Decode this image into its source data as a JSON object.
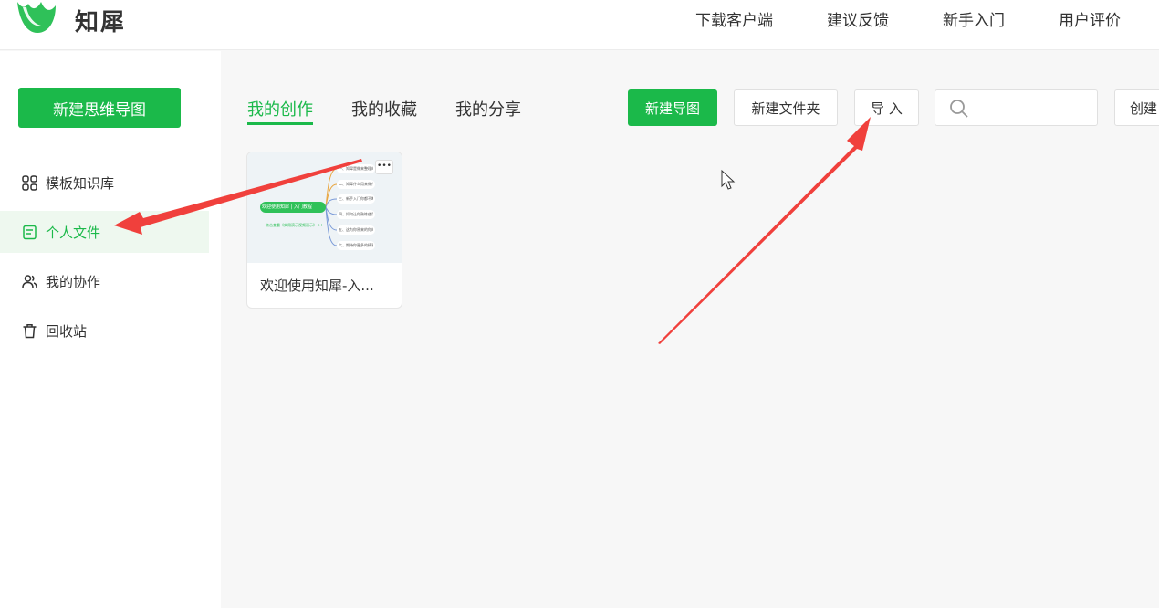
{
  "header": {
    "brand": "知犀",
    "nav": [
      "下载客户端",
      "建议反馈",
      "新手入门",
      "用户评价"
    ]
  },
  "sidebar": {
    "new_button": "新建思维导图",
    "items": [
      {
        "label": "模板知识库",
        "icon": "grid-icon"
      },
      {
        "label": "个人文件",
        "icon": "document-icon",
        "active": true
      },
      {
        "label": "我的协作",
        "icon": "users-icon"
      },
      {
        "label": "回收站",
        "icon": "trash-icon"
      }
    ]
  },
  "main": {
    "tabs": [
      {
        "label": "我的创作",
        "active": true
      },
      {
        "label": "我的收藏"
      },
      {
        "label": "我的分享"
      }
    ],
    "toolbar": {
      "new_map": "新建导图",
      "new_folder": "新建文件夹",
      "import": "导 入",
      "search_placeholder": "",
      "create": "创建"
    },
    "files": [
      {
        "title": "欢迎使用知犀-入...",
        "preview": {
          "root": "欢迎使用知犀 | 入门教程",
          "note": "点击查看《实用演示视频演示》 >>",
          "branches": [
            "一、知犀是做来整理的？",
            "二、知犀什么用来做什么",
            "三、新手入门你都不断介绍",
            "四、如何让你熟练使用功能",
            "五、这为你原来的你的优势",
            "六、期待你更多的精彩有充满"
          ]
        }
      }
    ]
  },
  "colors": {
    "accent": "#1bb94a",
    "arrow": "#f0403c"
  }
}
